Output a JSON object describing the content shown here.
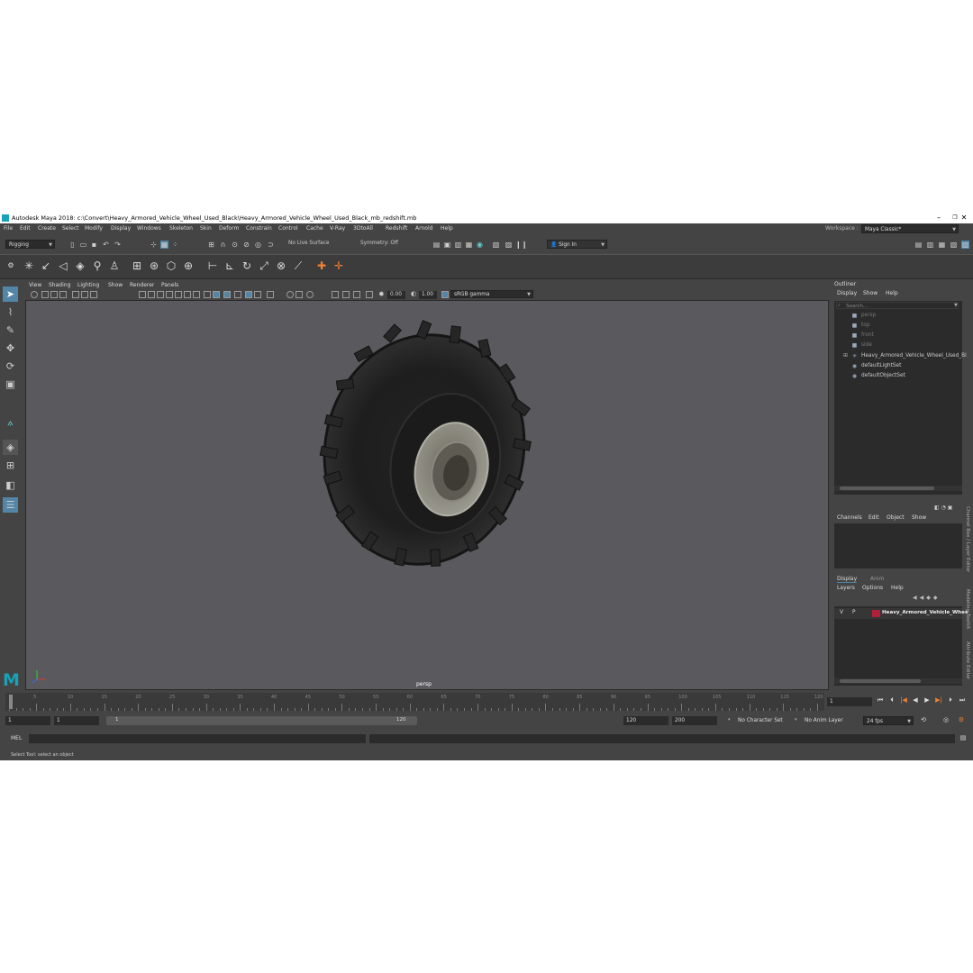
{
  "window": {
    "title": "Autodesk Maya 2018: c:\\Convert\\Heavy_Armored_Vehicle_Wheel_Used_Black\\Heavy_Armored_Vehicle_Wheel_Used_Black_mb_redshift.mb",
    "minimize": "–",
    "maximize": "❐",
    "close": "✕"
  },
  "menubar": {
    "items": [
      "File",
      "Edit",
      "Create",
      "Select",
      "Modify",
      "Display",
      "Windows",
      "Skeleton",
      "Skin",
      "Deform",
      "Constrain",
      "Control",
      "Cache",
      "V-Ray",
      "3DtoAll",
      "Redshift",
      "Arnold",
      "Help"
    ],
    "workspace_label": "Workspace :",
    "workspace_value": "Maya Classic*"
  },
  "status_line": {
    "menu_set": "Rigging",
    "live_surface": "No Live Surface",
    "symmetry": "Symmetry: Off",
    "sign_in": "Sign In"
  },
  "panel": {
    "menus": [
      "View",
      "Shading",
      "Lighting",
      "Show",
      "Renderer",
      "Panels"
    ],
    "exposure": "0.00",
    "gamma": "1.00",
    "color_space": "sRGB gamma",
    "camera_label": "persp"
  },
  "outliner": {
    "title": "Outliner",
    "menus": [
      "Display",
      "Show",
      "Help"
    ],
    "search_placeholder": "Search...",
    "items": [
      {
        "label": "persp",
        "dim": true
      },
      {
        "label": "top",
        "dim": true
      },
      {
        "label": "front",
        "dim": true
      },
      {
        "label": "side",
        "dim": true
      },
      {
        "label": "Heavy_Armored_Vehicle_Wheel_Used_Bl",
        "dim": false
      },
      {
        "label": "defaultLightSet",
        "dim": false
      },
      {
        "label": "defaultObjectSet",
        "dim": false
      }
    ]
  },
  "channel_box": {
    "menus": [
      "Channels",
      "Edit",
      "Object",
      "Show"
    ]
  },
  "layer_editor": {
    "tabs": [
      "Display",
      "Anim"
    ],
    "menus": [
      "Layers",
      "Options",
      "Help"
    ],
    "layer_v": "V",
    "layer_p": "P",
    "layer_name": "Heavy_Armored_Vehicle_Whee",
    "layer_color": "#b0203a"
  },
  "side_tabs": {
    "channel_box": "Channel Box / Layer Editor",
    "modeling_toolkit": "Modeling Toolkit",
    "attribute_editor": "Attribute Editor"
  },
  "timeline": {
    "ticks": [
      "5",
      "10",
      "15",
      "20",
      "25",
      "30",
      "35",
      "40",
      "45",
      "50",
      "55",
      "60",
      "65",
      "70",
      "75",
      "80",
      "85",
      "90",
      "95",
      "100",
      "105",
      "110",
      "115",
      "120"
    ],
    "current_frame": "1"
  },
  "range": {
    "start": "1",
    "playback_start": "1",
    "slider_start": "1",
    "slider_end": "120",
    "playback_end": "120",
    "end": "200",
    "character_set": "No Character Set",
    "anim_layer": "No Anim Layer",
    "fps": "24 fps"
  },
  "command_line": {
    "label": "MEL"
  },
  "help_line": {
    "text": "Select Tool: select an object"
  },
  "colors": {
    "ui_bg": "#444444",
    "viewport_bg": "#5a5a5e",
    "accent": "#5285a6",
    "maya_logo": "#17a2b8"
  }
}
